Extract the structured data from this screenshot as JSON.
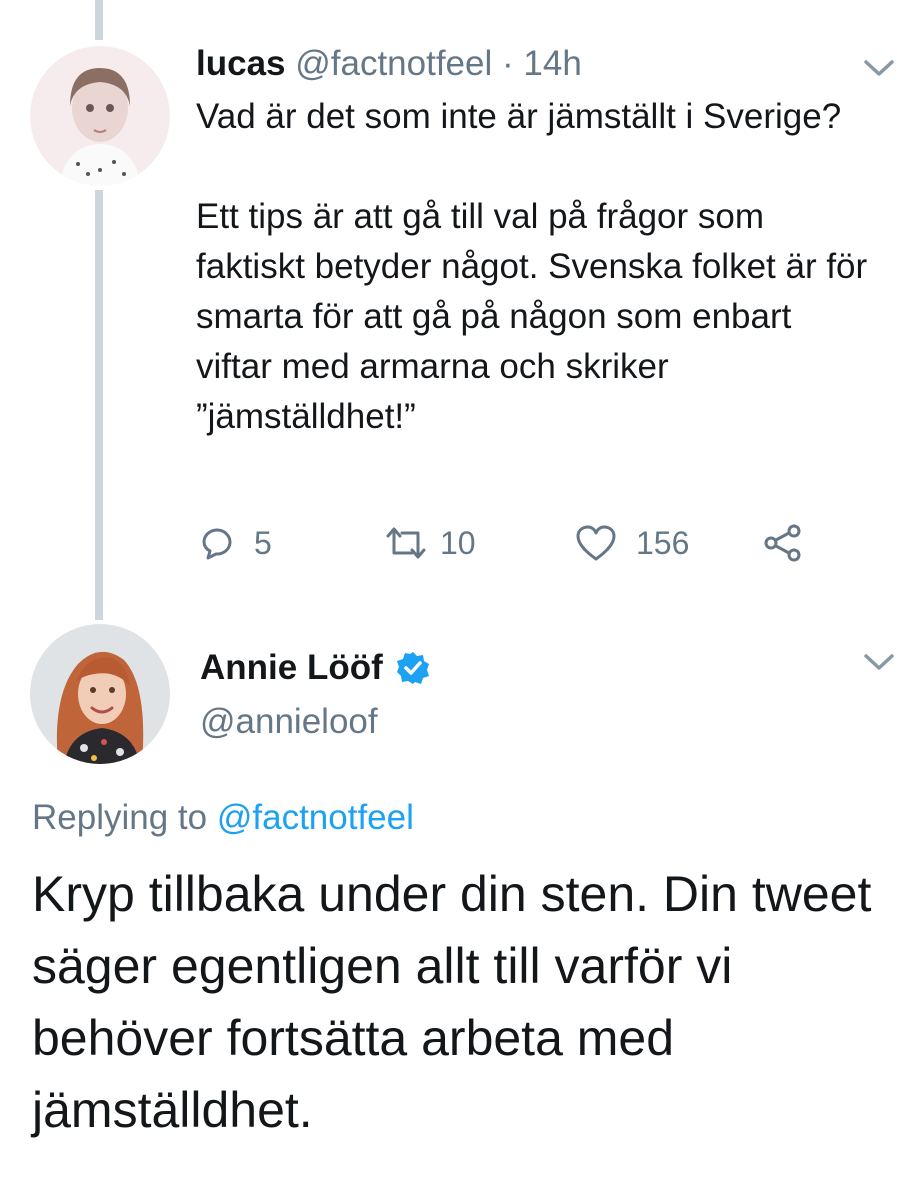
{
  "reply_target_tweet": {
    "author_name": "lucas",
    "author_handle": "@factnotfeel",
    "separator": "·",
    "timestamp": "14h",
    "paragraphs": [
      "Vad är det som inte är jämställt i Sverige?",
      "Ett tips är att gå till val på frågor som faktiskt betyder något. Svenska folket är för smarta för att gå på någon som enbart viftar med armarna och skriker ”jämställdhet!”"
    ],
    "actions": {
      "reply_count": "5",
      "retweet_count": "10",
      "like_count": "156"
    },
    "icons": {
      "reply": "reply-icon",
      "retweet": "retweet-icon",
      "like": "heart-icon",
      "share": "share-icon",
      "menu": "chevron-down-icon"
    }
  },
  "main_tweet": {
    "author_name": "Annie Lööf",
    "author_handle": "@annieloof",
    "verified": true,
    "replying_prefix": "Replying to",
    "replying_handle": "@factnotfeel",
    "text": "Kryp tillbaka under din sten. Din tweet säger egentligen allt till varför vi behöver fortsätta arbeta med jämställdhet.",
    "icons": {
      "verified": "verified-badge-icon",
      "menu": "chevron-down-icon"
    }
  },
  "colors": {
    "text": "#14171a",
    "muted": "#657786",
    "link": "#1da1f2",
    "thread_line": "#ccd6dd"
  }
}
